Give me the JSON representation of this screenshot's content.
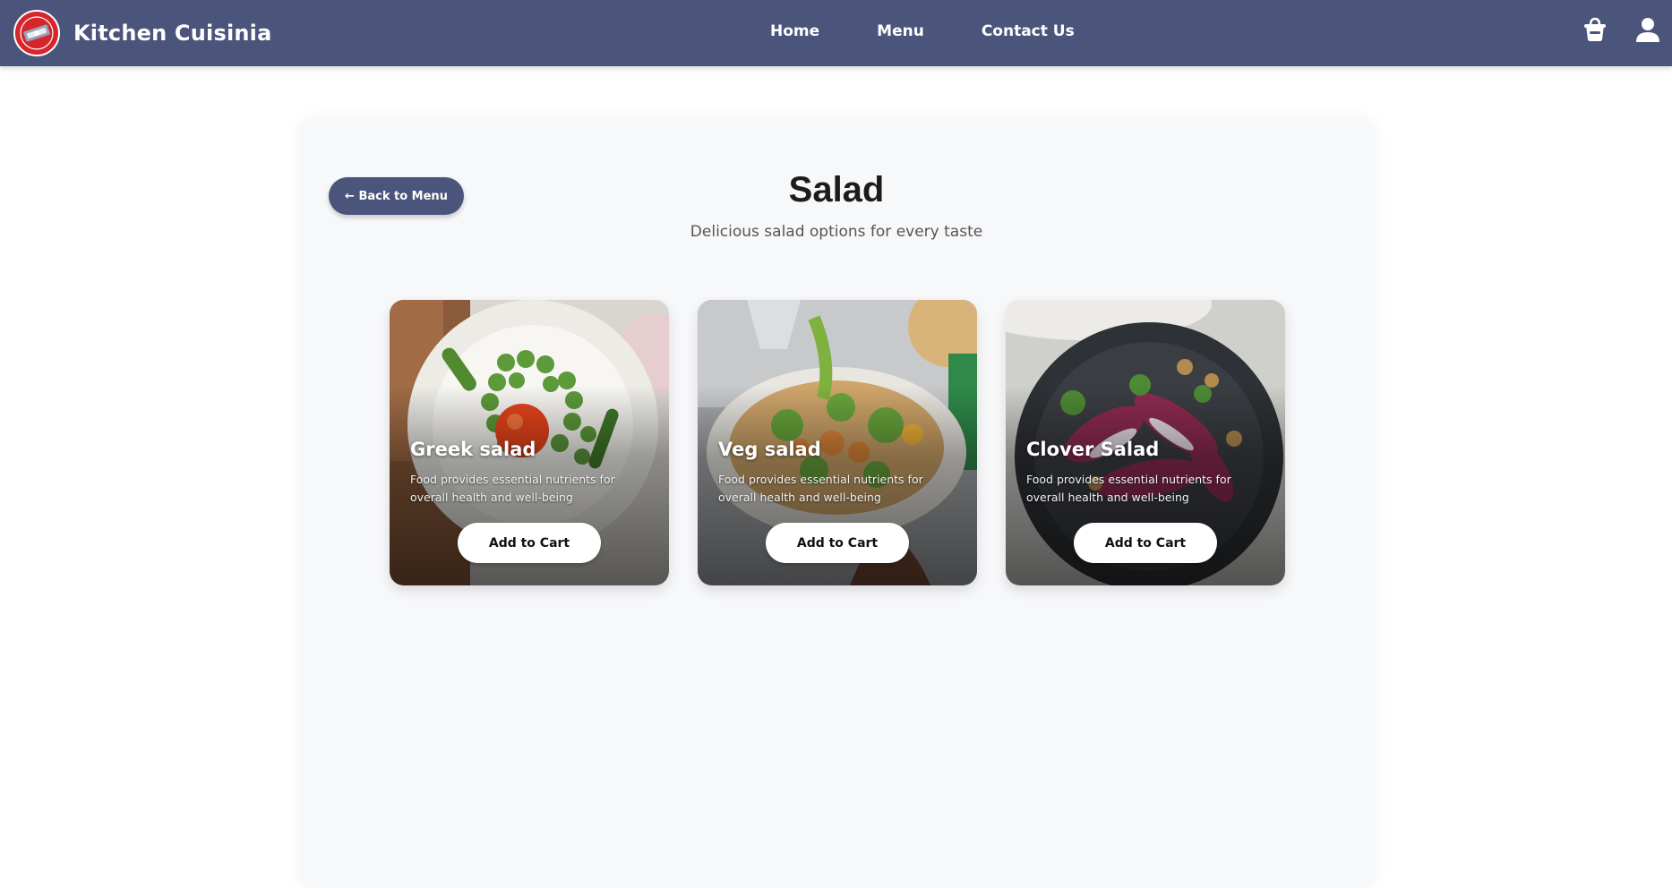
{
  "header": {
    "brand": "Kitchen Cuisinia",
    "nav": [
      "Home",
      "Menu",
      "Contact Us"
    ],
    "icons": {
      "cart": "basket-icon",
      "user": "user-icon"
    },
    "bg_color": "#4b557c"
  },
  "page": {
    "back_label": "← Back to Menu",
    "title": "Salad",
    "subtitle": "Delicious salad options for every taste"
  },
  "items": [
    {
      "name": "Greek salad",
      "desc": "Food provides essential nutrients for overall health and well-being",
      "button": "Add to Cart"
    },
    {
      "name": "Veg salad",
      "desc": "Food provides essential nutrients for overall health and well-being",
      "button": "Add to Cart"
    },
    {
      "name": "Clover Salad",
      "desc": "Food provides essential nutrients for overall health and well-being",
      "button": "Add to Cart"
    }
  ]
}
